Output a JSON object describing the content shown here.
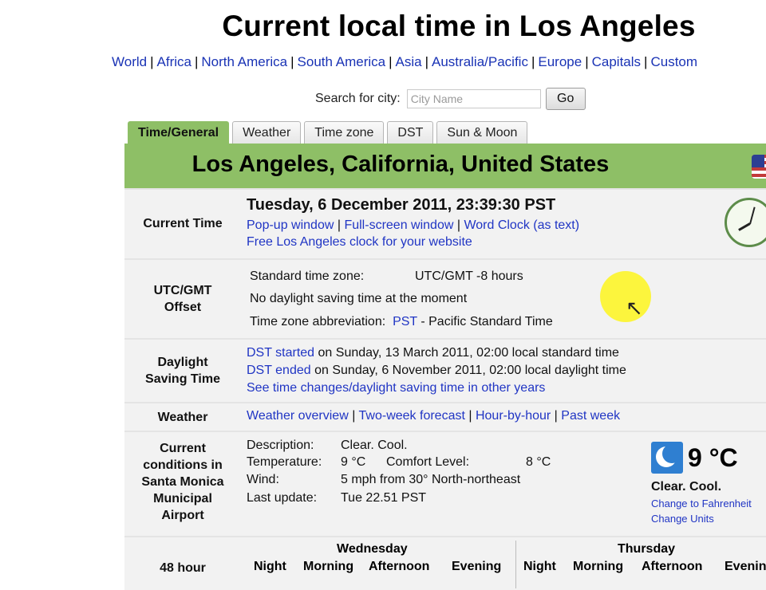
{
  "page": {
    "title": "Current local time in Los Angeles"
  },
  "regions": [
    "World",
    "Africa",
    "North America",
    "South America",
    "Asia",
    "Australia/Pacific",
    "Europe",
    "Capitals",
    "Custom"
  ],
  "search": {
    "label": "Search for city:",
    "placeholder": "City Name",
    "button": "Go"
  },
  "tabs": [
    "Time/General",
    "Weather",
    "Time zone",
    "DST",
    "Sun & Moon"
  ],
  "city": {
    "name": "Los Angeles, California, United States"
  },
  "current_time": {
    "label": "Current Time",
    "datetime": "Tuesday, 6 December 2011, 23:39:30 PST",
    "links": [
      "Pop-up window",
      "Full-screen window",
      "Word Clock (as text)"
    ],
    "free_clock": "Free Los Angeles clock for your website"
  },
  "utc": {
    "label1": "UTC/GMT",
    "label2": "Offset",
    "std_label": "Standard time zone:",
    "std_value": "UTC/GMT -8 hours",
    "no_dst": "No daylight saving time at the moment",
    "abbr_label": "Time zone abbreviation:",
    "abbr": "PST",
    "abbr_rest": "- Pacific Standard Time"
  },
  "dst": {
    "label1": "Daylight",
    "label2": "Saving Time",
    "started_link": "DST started",
    "started_rest": "on Sunday, 13 March 2011, 02:00 local standard time",
    "ended_link": "DST ended",
    "ended_rest": "on Sunday, 6 November 2011, 02:00 local daylight time",
    "see": "See time changes/daylight saving time in other years"
  },
  "weather": {
    "label": "Weather",
    "links": [
      "Weather overview",
      "Two-week forecast",
      "Hour-by-hour",
      "Past week"
    ]
  },
  "conditions": {
    "label": [
      "Current",
      "conditions in",
      "Santa Monica",
      "Municipal",
      "Airport"
    ],
    "desc_label": "Description:",
    "desc_value": "Clear. Cool.",
    "temp_label": "Temperature:",
    "temp_value": "9 °C",
    "comfort_label": "Comfort Level:",
    "comfort_value": "8 °C",
    "wind_label": "Wind:",
    "wind_value": "5 mph from 30° North-northeast",
    "update_label": "Last update:",
    "update_value": "Tue 22.51 PST",
    "big_temp": "9 °C",
    "big_desc": "Clear. Cool.",
    "change_f": "Change to Fahrenheit",
    "change_units": "Change Units"
  },
  "forecast": {
    "label": "48 hour",
    "day1": "Wednesday",
    "day2": "Thursday",
    "cols1": [
      "Night",
      "Morning",
      "Afternoon",
      "Evening"
    ],
    "cols2": [
      "Night",
      "Morning",
      "Afternoon",
      "Evening"
    ]
  },
  "colors": {
    "accent_green": "#8ebf66",
    "link_blue": "#2035c4"
  }
}
